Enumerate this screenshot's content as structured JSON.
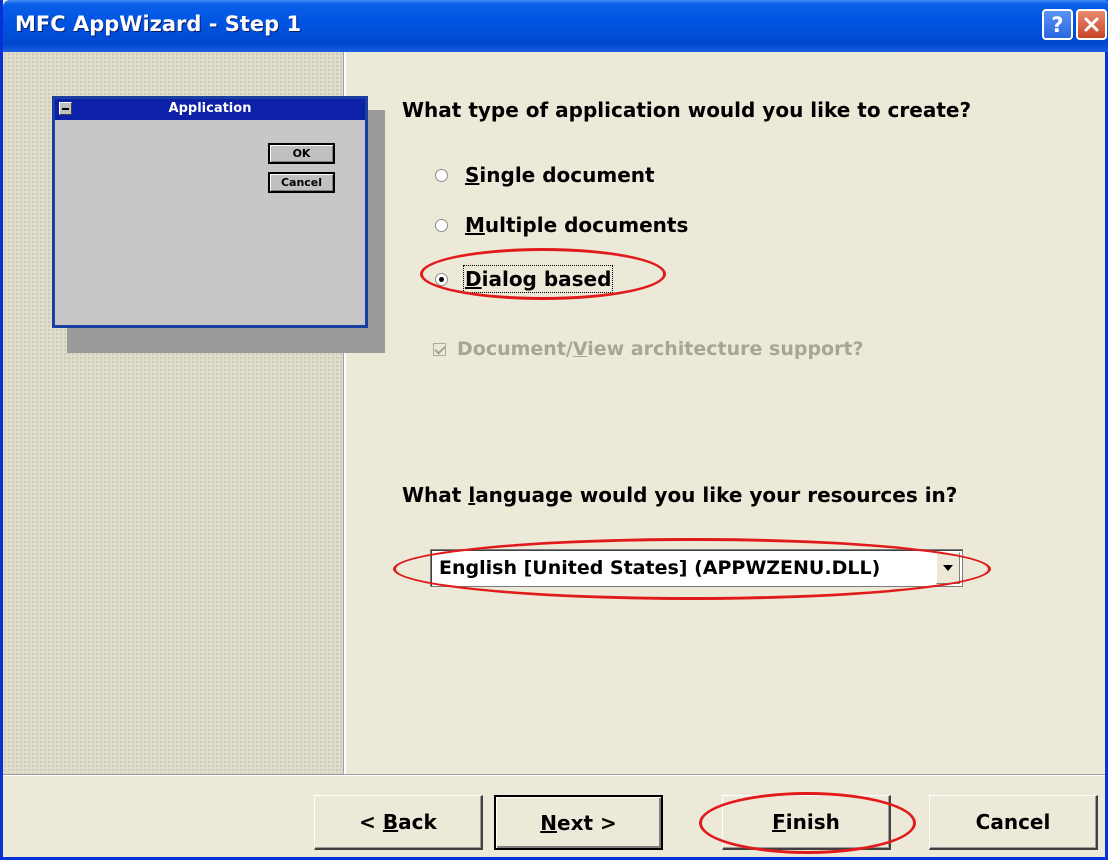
{
  "window": {
    "title": "MFC AppWizard - Step 1",
    "help_label": "?"
  },
  "preview": {
    "title": "Application",
    "ok_label": "OK",
    "cancel_label": "Cancel"
  },
  "app_type": {
    "question": "What type of application would you like to create?",
    "options": [
      {
        "mnemonic": "S",
        "rest": "ingle document",
        "checked": false
      },
      {
        "mnemonic": "M",
        "rest": "ultiple documents",
        "checked": false
      },
      {
        "mnemonic": "D",
        "rest": "ialog based",
        "checked": true
      }
    ]
  },
  "doc_view": {
    "label_before": "Document/",
    "mnemonic": "V",
    "label_after": "iew architecture support?",
    "checked": true,
    "enabled": false
  },
  "language": {
    "question_before": "What ",
    "mnemonic": "l",
    "question_after": "anguage would you like your resources in?",
    "selected": "English [United States] (APPWZENU.DLL)"
  },
  "buttons": {
    "back": {
      "prefix": "< ",
      "mnemonic": "B",
      "rest": "ack"
    },
    "next": {
      "mnemonic": "N",
      "rest": "ext >"
    },
    "finish": {
      "mnemonic": "F",
      "rest": "inish"
    },
    "cancel": {
      "label": "Cancel"
    }
  },
  "colors": {
    "titlebar": "#0054e3",
    "face": "#ece9d8",
    "annotation": "#e11b1b",
    "preview_title": "#0d20a8"
  },
  "icons": [
    "help-icon",
    "close-icon",
    "system-menu-icon",
    "dropdown-arrow-icon",
    "radio-icon",
    "checkbox-icon"
  ]
}
